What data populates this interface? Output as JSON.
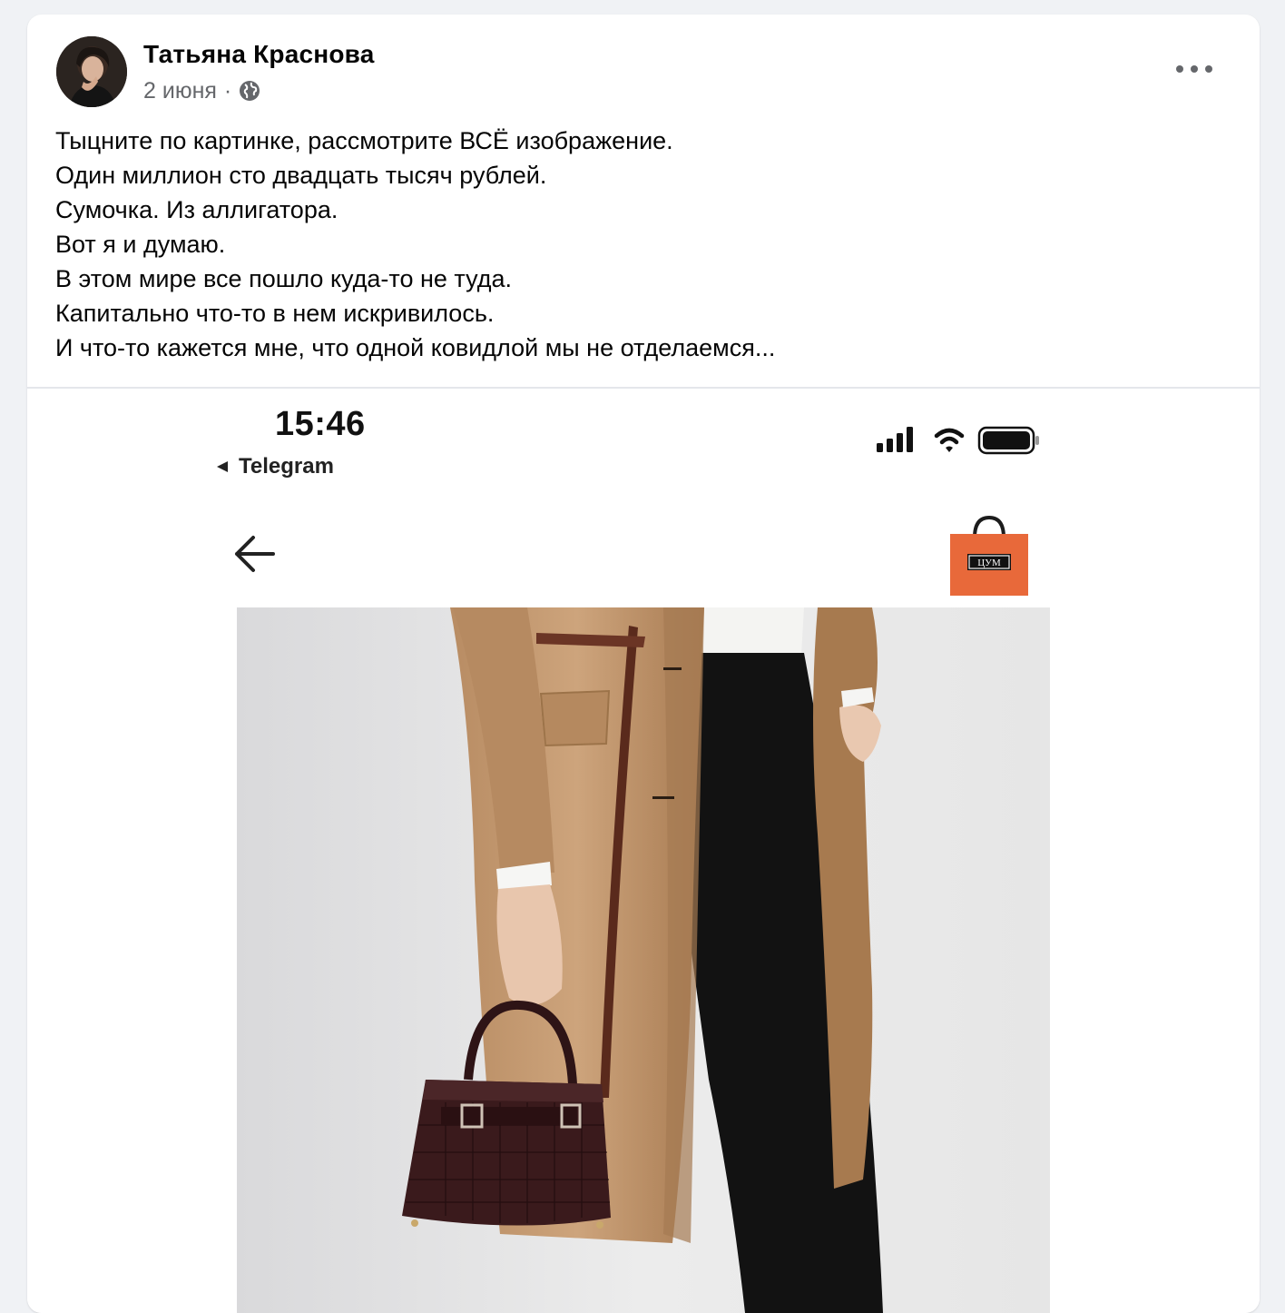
{
  "post": {
    "author": "Татьяна Краснова",
    "date": "2 июня",
    "separator": "·",
    "privacy_icon": "globe-icon",
    "more_icon": "more-horizontal-icon",
    "text_lines": [
      "Тыцните по картинке, рассмотрите ВСЁ изображение.",
      "Один миллион сто двадцать тысяч рублей.",
      "Сумочка. Из аллигатора.",
      "Вот я и думаю.",
      "В этом мире все пошло куда-то не туда.",
      "Капитально что-то в нем искривилось.",
      "И что-то кажется мне, что одной ковидлой мы не отделаемся..."
    ]
  },
  "screenshot": {
    "time": "15:46",
    "back_app": "Telegram",
    "back_arrow_icon": "arrow-left-icon",
    "cart_icon": "shopping-bag-icon",
    "shop_logo_text": "ЦУМ",
    "photo_description_icon": "product-photo",
    "colors": {
      "bag_logo_orange": "#e8693a",
      "coat_camel": "#c79f77",
      "trousers_black": "#121212",
      "handbag_burgundy": "#3a1a1c"
    }
  }
}
